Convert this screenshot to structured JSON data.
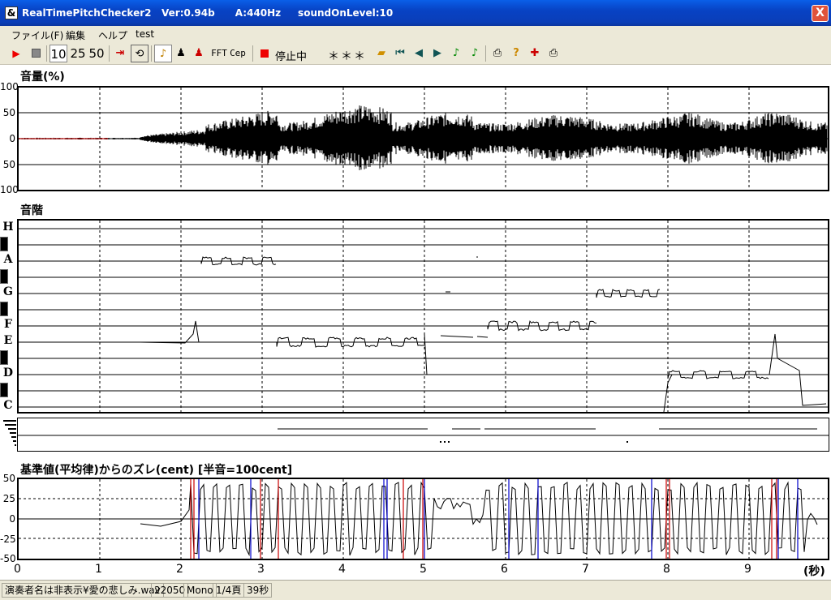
{
  "window": {
    "title": "RealTimePitchChecker2   Ver:0.94b      A:440Hz     soundOnLevel:10",
    "app_icon": "&",
    "close_symbol": "X"
  },
  "menu": [
    "ファイル(F)",
    "編集",
    "ヘルプ",
    "test"
  ],
  "toolbar": {
    "play_icon": "play-icon",
    "stop_icon": "stop-icon",
    "zoom_10": "10",
    "zoom_25": "25",
    "zoom_50": "50",
    "fft_label": "FFT",
    "cep_label": "Cep",
    "status_label": "停止中",
    "marker_text": "＊＊＊"
  },
  "volume_panel": {
    "title": "音量(%)",
    "y_labels": [
      "100",
      "50",
      "0",
      "50",
      "100"
    ]
  },
  "scale_panel": {
    "title": "音階",
    "notes": [
      "H",
      "A",
      "G",
      "F",
      "E",
      "D",
      "C"
    ]
  },
  "deviation_panel": {
    "title": "基準値(平均律)からのズレ(cent) [半音=100cent]",
    "y_labels": [
      "50",
      "25",
      "0",
      "-25",
      "-50"
    ]
  },
  "x_axis": {
    "ticks": [
      "0",
      "1",
      "2",
      "3",
      "4",
      "5",
      "6",
      "7",
      "8",
      "9"
    ],
    "unit": "(秒)"
  },
  "status_bar": {
    "file": "演奏者名は非表示¥愛の悲しみ.wav",
    "sample_rate": "22050",
    "channels": "Mono",
    "page": "1/4頁",
    "duration": "39秒"
  },
  "colors": {
    "title_bar": "#0a4fd8",
    "waveform": "#000000",
    "deviation_red": "#cc0000",
    "deviation_blue": "#0000cc"
  }
}
